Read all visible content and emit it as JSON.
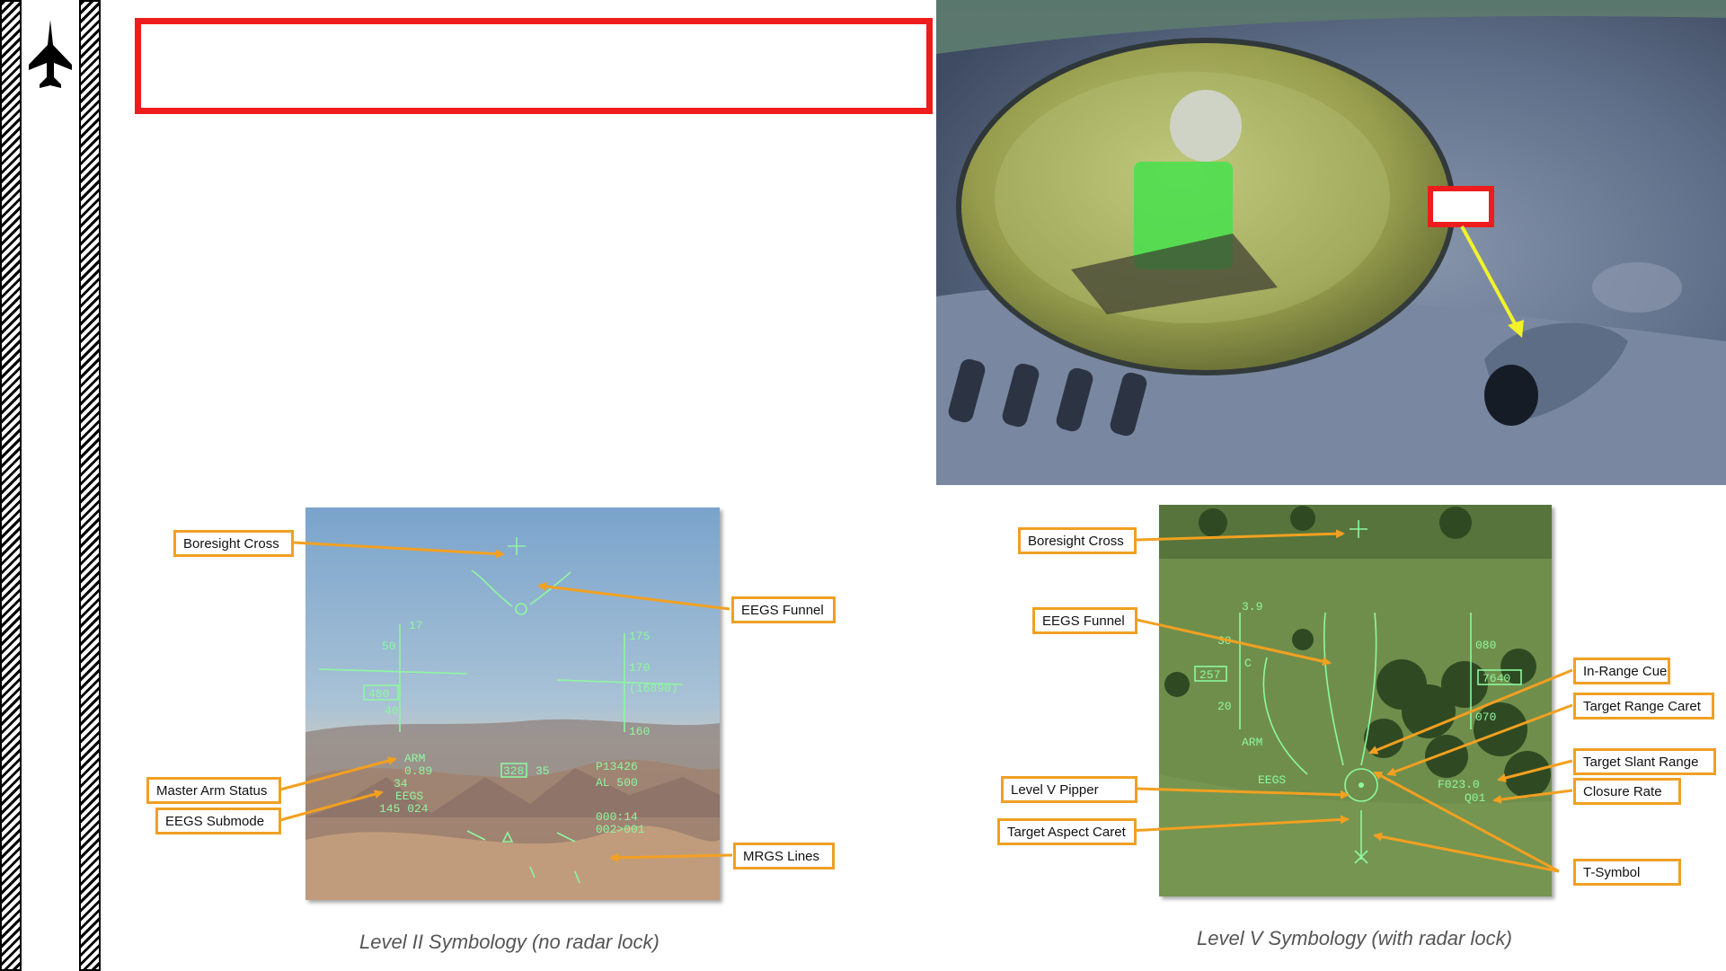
{
  "hud_level2": {
    "callouts": {
      "boresight": "Boresight Cross",
      "eegs_funnel": "EEGS Funnel",
      "master_arm": "Master Arm Status",
      "eegs_submode": "EEGS Submode",
      "mrgs_lines": "MRGS Lines"
    },
    "caption": "Level II Symbology (no radar lock)"
  },
  "hud_level5": {
    "callouts": {
      "boresight": "Boresight Cross",
      "eegs_funnel": "EEGS Funnel",
      "in_range": "In-Range Cue",
      "target_range_caret": "Target Range Caret",
      "target_slant_range": "Target Slant Range",
      "closure_rate": "Closure Rate",
      "level5_pipper": "Level V Pipper",
      "target_aspect_caret": "Target Aspect Caret",
      "t_symbol": "T-Symbol"
    },
    "caption": "Level V Symbology (with radar lock)"
  },
  "colors": {
    "callout_border": "#f0a023",
    "arrow": "#f3a020",
    "highlight_box": "#ee1c1c",
    "pointer_arrow": "#f2f22a",
    "hud_symbology": "#8ef7a0"
  },
  "icons": {
    "sidebar": "jet-icon"
  }
}
